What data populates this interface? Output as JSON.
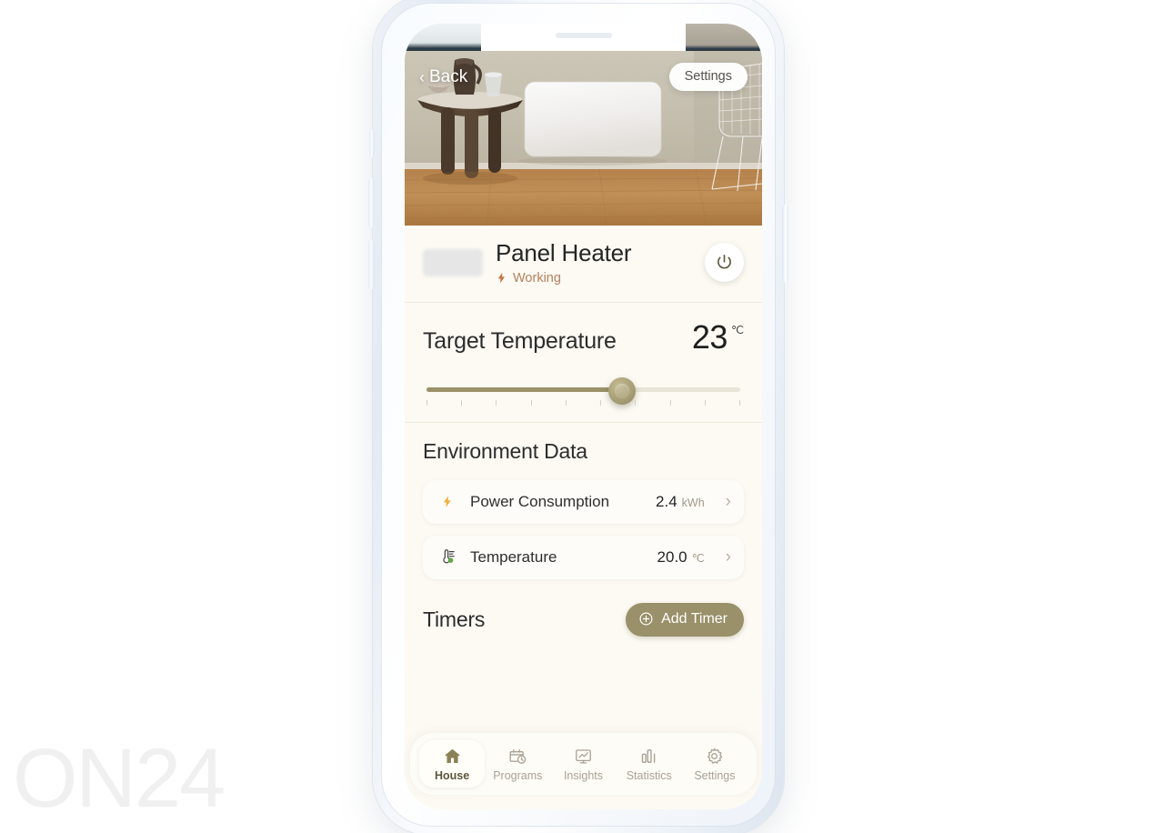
{
  "watermark": {
    "text": "ON24"
  },
  "hero": {
    "back_label": "Back",
    "back_chevron": "‹",
    "settings_label": "Settings"
  },
  "device": {
    "name": "Panel Heater",
    "status": "Working",
    "status_icon": "bolt-icon",
    "power_icon": "power-icon"
  },
  "target": {
    "label": "Target Temperature",
    "value": "23",
    "unit": "℃",
    "slider_percent": 62,
    "tick_count": 10
  },
  "environment": {
    "title": "Environment Data",
    "rows": [
      {
        "icon": "bolt-icon",
        "label": "Power Consumption",
        "value": "2.4",
        "unit": "kWh",
        "chevron": "›"
      },
      {
        "icon": "thermometer-icon",
        "label": "Temperature",
        "value": "20.0",
        "unit": "℃",
        "chevron": "›"
      }
    ]
  },
  "timers": {
    "title": "Timers",
    "add_label": "Add Timer",
    "add_icon": "plus-circle-icon"
  },
  "tabbar": {
    "items": [
      {
        "label": "House",
        "icon": "home-icon",
        "active": true
      },
      {
        "label": "Programs",
        "icon": "calendar-clock-icon",
        "active": false
      },
      {
        "label": "Insights",
        "icon": "chart-board-icon",
        "active": false
      },
      {
        "label": "Statistics",
        "icon": "bar-chart-icon",
        "active": false
      },
      {
        "label": "Settings",
        "icon": "gear-icon",
        "active": false
      }
    ]
  },
  "colors": {
    "accent_olive": "#9a9069",
    "status_orange": "#b5815c",
    "bolt_amber": "#f0b03c",
    "thermo_green": "#62a84a",
    "sheet_bg": "#fcfaf3"
  }
}
